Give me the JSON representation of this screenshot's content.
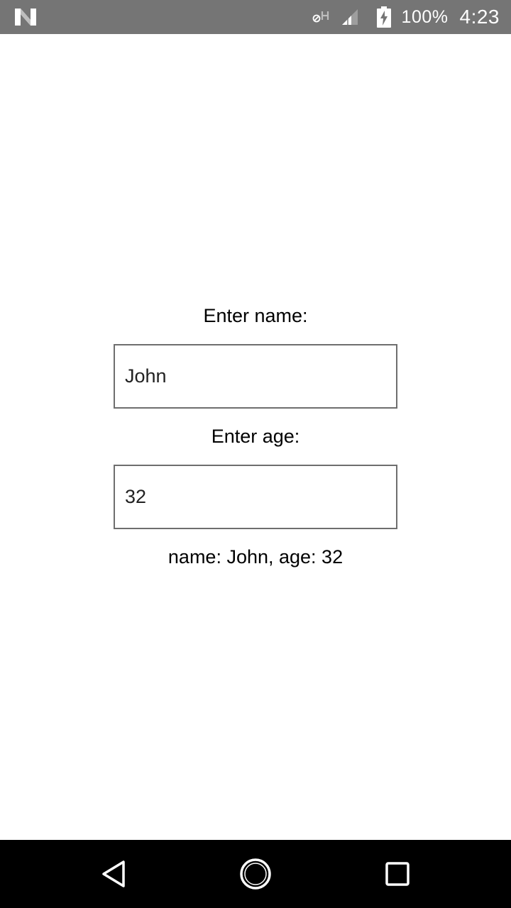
{
  "status_bar": {
    "battery_percent": "100%",
    "time": "4:23",
    "icons": [
      "n-logo-icon",
      "hd-voice-icon",
      "signal-icon",
      "battery-charging-icon"
    ]
  },
  "form": {
    "name_label": "Enter name:",
    "name_value": "John",
    "age_label": "Enter age:",
    "age_value": "32",
    "summary": "name: John, age: 32"
  },
  "nav_bar": {
    "icons": [
      "back-icon",
      "home-icon",
      "recents-icon"
    ]
  },
  "colors": {
    "status_bar_bg": "#757575",
    "nav_bar_bg": "#000000",
    "input_border": "#6e6e6e",
    "background": "#ffffff"
  }
}
